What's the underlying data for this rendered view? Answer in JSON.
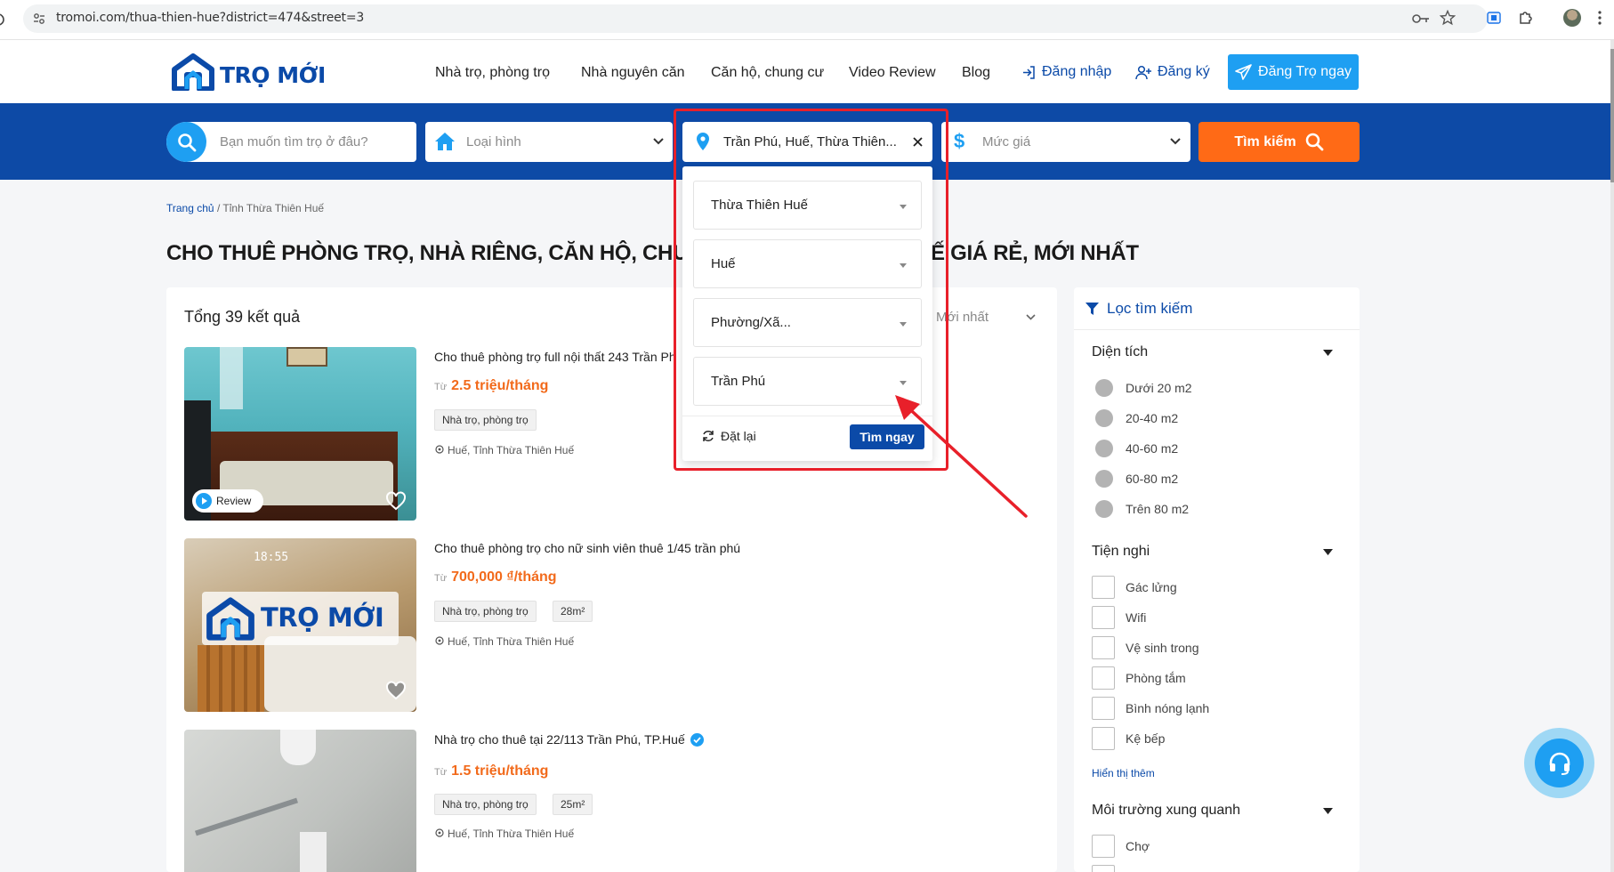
{
  "browser": {
    "url": "tromoi.com/thua-thien-hue?district=474&street=3"
  },
  "header": {
    "logo_text": "TRỌ MỚI",
    "nav": [
      "Nhà trọ, phòng trọ",
      "Nhà nguyên căn",
      "Căn hộ, chung cư",
      "Video Review",
      "Blog"
    ],
    "login": "Đăng nhập",
    "register": "Đăng ký",
    "post_button": "Đăng Trọ ngay"
  },
  "search": {
    "keyword_placeholder": "Bạn muốn tìm trọ ở đâu?",
    "type_placeholder": "Loại hình",
    "location_value": "Trần Phú, Huế, Thừa Thiên...",
    "price_placeholder": "Mức giá",
    "search_button": "Tìm kiếm"
  },
  "location_dropdown": {
    "province": "Thừa Thiên Huế",
    "district": "Huế",
    "ward": "Phường/Xã...",
    "street": "Trần Phú",
    "reset": "Đặt lại",
    "apply": "Tìm ngay"
  },
  "breadcrumb": {
    "home": "Trang chủ",
    "separator": "/",
    "current": "Tỉnh Thừa Thiên Huế"
  },
  "page_title": {
    "left": "CHO THUÊ PHÒNG TRỌ, NHÀ RIÊNG, CĂN HỘ, CHU",
    "right": "Ế GIÁ RẺ, MỚI NHẤT"
  },
  "results": {
    "total": "Tổng 39 kết quả",
    "sort": "Mới nhất",
    "listings": [
      {
        "title": "Cho thuê phòng trọ full nội thất 243 Trần Ph",
        "price_from": "Từ",
        "price": "2.5 triệu/tháng",
        "tags": [
          "Nhà trọ, phòng trọ"
        ],
        "location": "Huế, Tỉnh Thừa Thiên Huế",
        "badge": "Review"
      },
      {
        "title": "Cho thuê phòng trọ cho nữ sinh viên thuê 1/45 trần phú",
        "price_from": "Từ",
        "price": "700,000 ₫/tháng",
        "tags": [
          "Nhà trọ, phòng trọ",
          "28m²"
        ],
        "location": "Huế, Tỉnh Thừa Thiên Huế",
        "watermark": "TRỌ MỚI",
        "photo_time": "18:55"
      },
      {
        "title": "Nhà trọ cho thuê tại 22/113 Trần Phú, TP.Huế",
        "price_from": "Từ",
        "price": "1.5 triệu/tháng",
        "tags": [
          "Nhà trọ, phòng trọ",
          "25m²"
        ],
        "location": "Huế, Tỉnh Thừa Thiên Huế"
      }
    ]
  },
  "filter": {
    "title": "Lọc tìm kiếm",
    "area": {
      "label": "Diện tích",
      "options": [
        "Dưới 20 m2",
        "20-40 m2",
        "40-60 m2",
        "60-80 m2",
        "Trên 80 m2"
      ]
    },
    "amenities": {
      "label": "Tiện nghi",
      "options": [
        "Gác lửng",
        "Wifi",
        "Vệ sinh trong",
        "Phòng tắm",
        "Bình nóng lạnh",
        "Kệ bếp"
      ],
      "show_more": "Hiển thị thêm"
    },
    "environment": {
      "label": "Môi trường xung quanh",
      "options": [
        "Chợ"
      ]
    }
  },
  "colors": {
    "brand_blue": "#0d4aa6",
    "accent_orange": "#ff6a16",
    "price_orange": "#f26a1b",
    "annotation_red": "#e8202a",
    "light_blue": "#1e9ff2"
  }
}
